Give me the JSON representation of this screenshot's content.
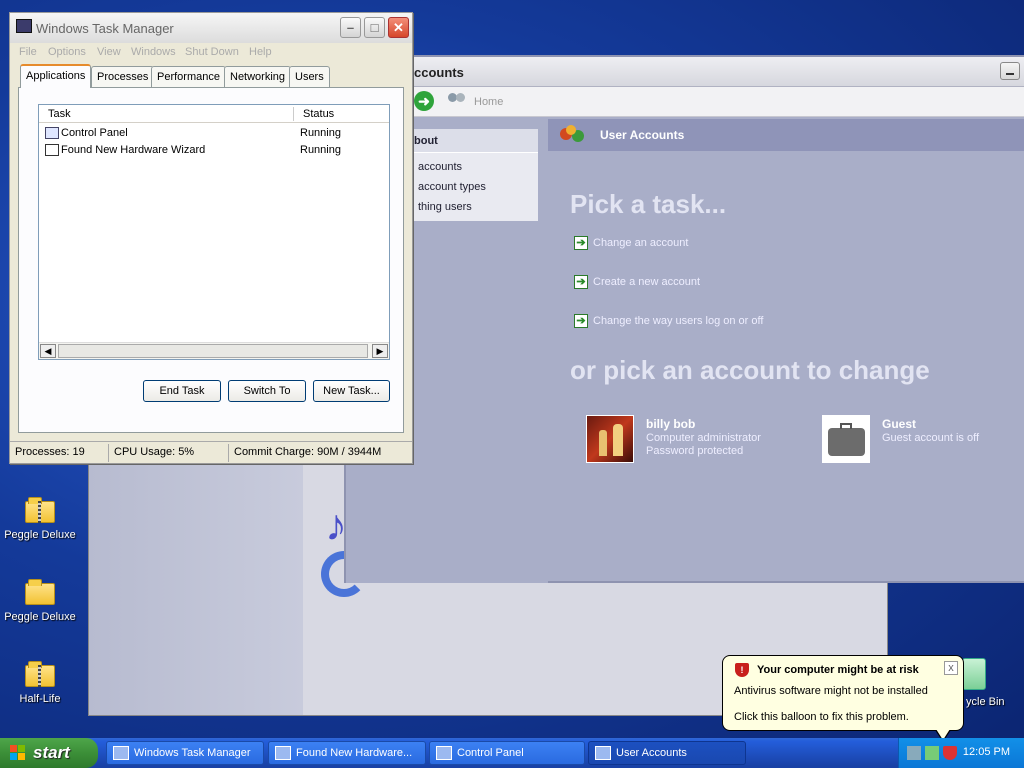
{
  "desktop": {
    "icons": [
      {
        "label": "Peggle Deluxe",
        "type": "zip"
      },
      {
        "label": "Peggle Deluxe",
        "type": "folder"
      },
      {
        "label": "Half-Life",
        "type": "zip"
      }
    ],
    "recycle_label": "ycle Bin"
  },
  "task_manager": {
    "title": "Windows Task Manager",
    "menu": [
      "File",
      "Options",
      "View",
      "Windows",
      "Shut Down",
      "Help"
    ],
    "tabs": [
      "Applications",
      "Processes",
      "Performance",
      "Networking",
      "Users"
    ],
    "active_tab": "Applications",
    "columns": [
      "Task",
      "Status"
    ],
    "rows": [
      {
        "task": "Control Panel",
        "status": "Running"
      },
      {
        "task": "Found New Hardware Wizard",
        "status": "Running"
      }
    ],
    "buttons": {
      "end_task": "End Task",
      "switch_to": "Switch To",
      "new_task": "New Task..."
    },
    "status": {
      "processes": "Processes: 19",
      "cpu": "CPU Usage: 5%",
      "commit": "Commit Charge: 90M / 3944M"
    }
  },
  "user_accounts": {
    "title": "ccounts",
    "toolbar_home": "Home",
    "left_panel": {
      "header": "bout",
      "items": [
        "accounts",
        "account types",
        "thing users"
      ]
    },
    "header": "User Accounts",
    "pick_task": "Pick a task...",
    "tasks": [
      "Change an account",
      "Create a new account",
      "Change the way users log on or off"
    ],
    "pick_account": "or pick an account to change",
    "accounts": [
      {
        "name": "billy bob",
        "line1": "Computer administrator",
        "line2": "Password protected"
      },
      {
        "name": "Guest",
        "line1": "Guest account is off",
        "line2": ""
      }
    ]
  },
  "balloon": {
    "title": "Your computer might be at risk",
    "line1": "Antivirus software might not be installed",
    "line2": "Click this balloon to fix this problem.",
    "close": "x"
  },
  "taskbar": {
    "start": "start",
    "buttons": [
      "Windows Task Manager",
      "Found New Hardware...",
      "Control Panel",
      "User Accounts"
    ],
    "active_button": "User Accounts",
    "clock": "12:05 PM"
  }
}
